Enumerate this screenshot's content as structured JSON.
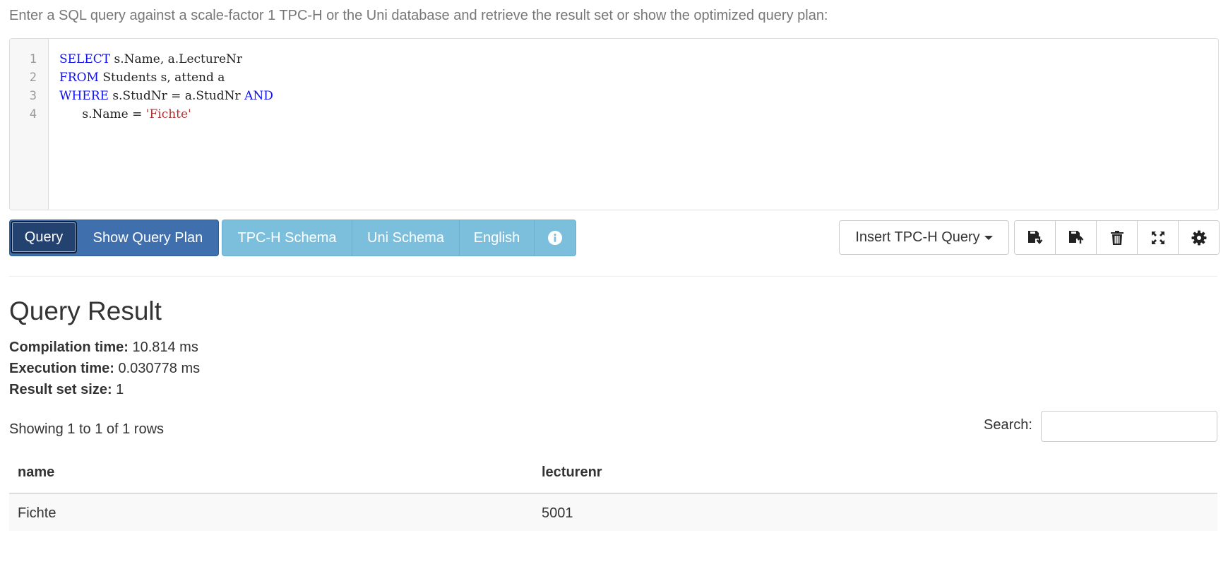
{
  "intro_text": "Enter a SQL query against a scale-factor 1 TPC-H or the Uni database and retrieve the result set or show the optimized query plan:",
  "editor": {
    "line_numbers": [
      "1",
      "2",
      "3",
      "4"
    ],
    "lines": [
      [
        {
          "t": "SELECT",
          "k": "kw"
        },
        {
          "t": " s.Name, a.LectureNr",
          "k": ""
        }
      ],
      [
        {
          "t": "FROM",
          "k": "kw"
        },
        {
          "t": " Students s, attend a",
          "k": ""
        }
      ],
      [
        {
          "t": "WHERE",
          "k": "kw"
        },
        {
          "t": " s.StudNr = a.StudNr ",
          "k": ""
        },
        {
          "t": "AND",
          "k": "kw"
        }
      ],
      [
        {
          "t": "      s.Name = ",
          "k": ""
        },
        {
          "t": "'Fichte'",
          "k": "str"
        }
      ]
    ]
  },
  "toolbar": {
    "query_label": "Query",
    "plan_label": "Show Query Plan",
    "tpch_schema_label": "TPC-H Schema",
    "uni_schema_label": "Uni Schema",
    "language_label": "English",
    "insert_query_label": "Insert TPC-H Query",
    "icons": [
      "save-download-icon",
      "save-upload-icon",
      "trash-icon",
      "fullscreen-icon",
      "gear-icon"
    ]
  },
  "result": {
    "title": "Query Result",
    "compilation_label": "Compilation time:",
    "compilation_value": " 10.814 ms",
    "execution_label": "Execution time:",
    "execution_value": " 0.030778 ms",
    "size_label": "Result set size:",
    "size_value": " 1",
    "showing_text": "Showing 1 to 1 of 1 rows",
    "search_label": "Search:",
    "columns": [
      "name",
      "lecturenr"
    ],
    "rows": [
      [
        "Fichte",
        "5001"
      ]
    ]
  },
  "colors": {
    "primary": "#3f6fad",
    "primary_active": "#23426f",
    "info": "#7bbfdc",
    "keyword": "#1010ee",
    "string": "#a33333"
  }
}
